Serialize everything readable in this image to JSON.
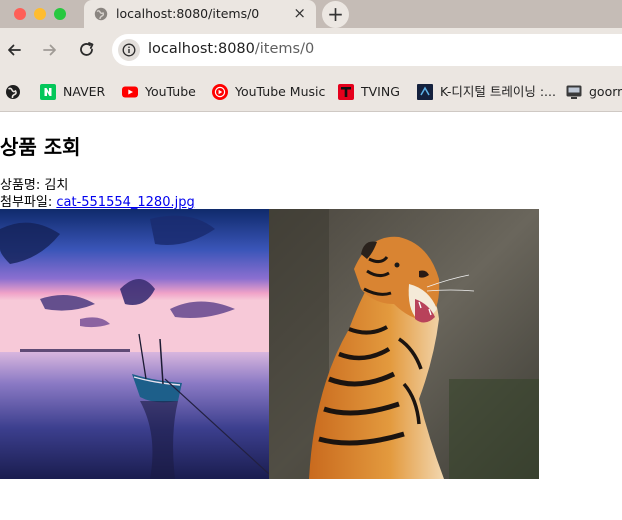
{
  "window": {
    "tab_title": "localhost:8080/items/0",
    "tab_close": "×",
    "new_tab": "+"
  },
  "toolbar": {
    "url_host": "localhost:8080",
    "url_path": "/items/0"
  },
  "bookmarks": [
    {
      "label": "",
      "icon": "globe-icon"
    },
    {
      "label": "NAVER",
      "icon": "naver-icon"
    },
    {
      "label": "YouTube",
      "icon": "youtube-icon"
    },
    {
      "label": "YouTube Music",
      "icon": "youtube-music-icon"
    },
    {
      "label": "TVING",
      "icon": "tving-icon"
    },
    {
      "label": "K-디지털 트레이닝 :...",
      "icon": "k-digital-icon"
    },
    {
      "label": "goorm",
      "icon": "goorm-icon"
    }
  ],
  "page": {
    "title": "상품 조회",
    "item_name_label": "상품명: ",
    "item_name": "김치",
    "attachment_label": "첨부파일: ",
    "attachment_file": "cat-551554_1280.jpg",
    "images": [
      {
        "subject": "sunset-boat-photo"
      },
      {
        "subject": "roaring-tiger-photo"
      }
    ]
  },
  "colors": {
    "tabstrip": "#c5bcb6",
    "toolbar": "#ebe6e1",
    "link": "#0000ee"
  }
}
